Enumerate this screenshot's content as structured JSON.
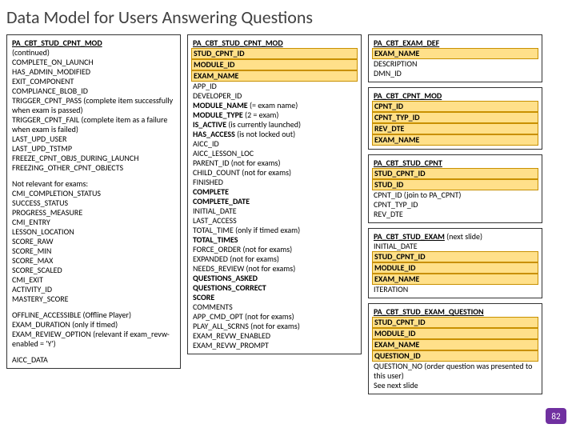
{
  "title": "Data Model for Users Answering Questions",
  "page_number": "82",
  "col1": {
    "box1": {
      "title": "PA_CBT_STUD_CPNT_MOD",
      "continued": "(continued)",
      "fields": [
        "COMPLETE_ON_LAUNCH",
        "HAS_ADMIN_MODIFIED",
        "EXIT_COMPONENT",
        "COMPLIANCE_BLOB_ID"
      ],
      "trigger_pass": "TRIGGER_CPNT_PASS (complete item successfully when exam is passed)",
      "trigger_fail": "TRIGGER_CPNT_FAIL  (complete item as a failure when exam is failed)",
      "fields2": [
        "LAST_UPD_USER",
        "LAST_UPD_TSTMP",
        "FREEZE_CPNT_OBJS_DURING_LAUNCH",
        "FREEZING_OTHER_CPNT_OBJECTS"
      ],
      "not_relevant_label": "Not relevant for exams:",
      "not_relevant": [
        "CMI_COMPLETION_STATUS",
        "SUCCESS_STATUS",
        "PROGRESS_MEASURE",
        "CMI_ENTRY",
        "LESSON_LOCATION",
        "SCORE_RAW",
        "SCORE_MIN",
        "SCORE_MAX",
        "SCORE_SCALED",
        "CMI_EXIT",
        "ACTIVITY_ID",
        "MASTERY_SCORE"
      ],
      "offline": "OFFLINE_ACCESSIBLE  (Offline Player)",
      "exam_dur": "EXAM_DURATION  (only if timed)",
      "exam_rev": "EXAM_REVIEW_OPTION  (relevant if exam_revw-enabled = 'Y')",
      "aicc": "AICC_DATA"
    }
  },
  "col2": {
    "box1": {
      "title": "PA_CBT_STUD_CPNT_MOD",
      "fk1": "STUD_CPNT_ID",
      "fk2": "MODULE_ID",
      "fk3": "EXAM_NAME",
      "r1": "APP_ID",
      "r2": "DEVELOPER_ID",
      "r3a": "MODULE_NAME",
      "r3b": "  (= exam name)",
      "r4a": "MODULE_TYPE",
      "r4b": "   (2 = exam)",
      "r5a": "IS_ACTIVE",
      "r5b": "  (is currently launched)",
      "r6a": "HAS_ACCESS",
      "r6b": "  (is not locked out)",
      "r7": "AICC_ID",
      "r8": "AICC_LESSON_LOC",
      "r9": "PARENT_ID  (not for exams)",
      "r10": "CHILD_COUNT  (not for exams)",
      "r11": "FINISHED",
      "r12": "COMPLETE",
      "r13": "COMPLETE_DATE",
      "r14": "INITIAL_DATE",
      "r15": "LAST_ACCESS",
      "r16": "TOTAL_TIME  (only if timed exam)",
      "r17": "TOTAL_TIMES",
      "r18": "FORCE_ORDER  (not for exams)",
      "r19": "EXPANDED (not for exams)",
      "r20": "NEEDS_REVIEW  (not for exams)",
      "r21": "QUESTIONS_ASKED",
      "r22": "QUESTIONS_CORRECT",
      "r23": "SCORE",
      "r24": "COMMENTS",
      "r25": "APP_CMD_OPT  (not for exams)",
      "r26": "PLAY_ALL_SCRNS  (not for exams)",
      "r27": "EXAM_REVW_ENABLED",
      "r28": "EXAM_REVW_PROMPT"
    }
  },
  "col3": {
    "box_exam_def": {
      "title": "PA_CBT_EXAM_DEF",
      "fk1": "EXAM_NAME",
      "r1": "DESCRIPTION",
      "r2": "DMN_ID"
    },
    "box_cpnt_mod": {
      "title": "PA_CBT_CPNT_MOD",
      "fk1": "CPNT_ID",
      "fk2": "CPNT_TYP_ID",
      "fk3": "REV_DTE",
      "fk4": "EXAM_NAME"
    },
    "box_stud_cpnt": {
      "title": "PA_CBT_STUD_CPNT",
      "fk1": "STUD_CPNT_ID",
      "fk2": "STUD_ID",
      "r1": "CPNT_ID  (join to PA_CPNT)",
      "r2": "CPNT_TYP_ID",
      "r3": "REV_DTE"
    },
    "box_stud_exam": {
      "title": "PA_CBT_STUD_EXAM",
      "title_note": " (next slide)",
      "r0": "INITIAL_DATE",
      "fk1": "STUD_CPNT_ID",
      "fk2": "MODULE_ID",
      "fk3": "EXAM_NAME",
      "r1": "ITERATION"
    },
    "box_stud_exam_q": {
      "title": "PA_CBT_STUD_EXAM_QUESTION",
      "fk1": "STUD_CPNT_ID",
      "fk2": "MODULE_ID",
      "fk3": "EXAM_NAME",
      "fk4": "QUESTION_ID",
      "r1": "QUESTION_NO  (order question was presented to this user)",
      "r2": "See next slide"
    }
  }
}
